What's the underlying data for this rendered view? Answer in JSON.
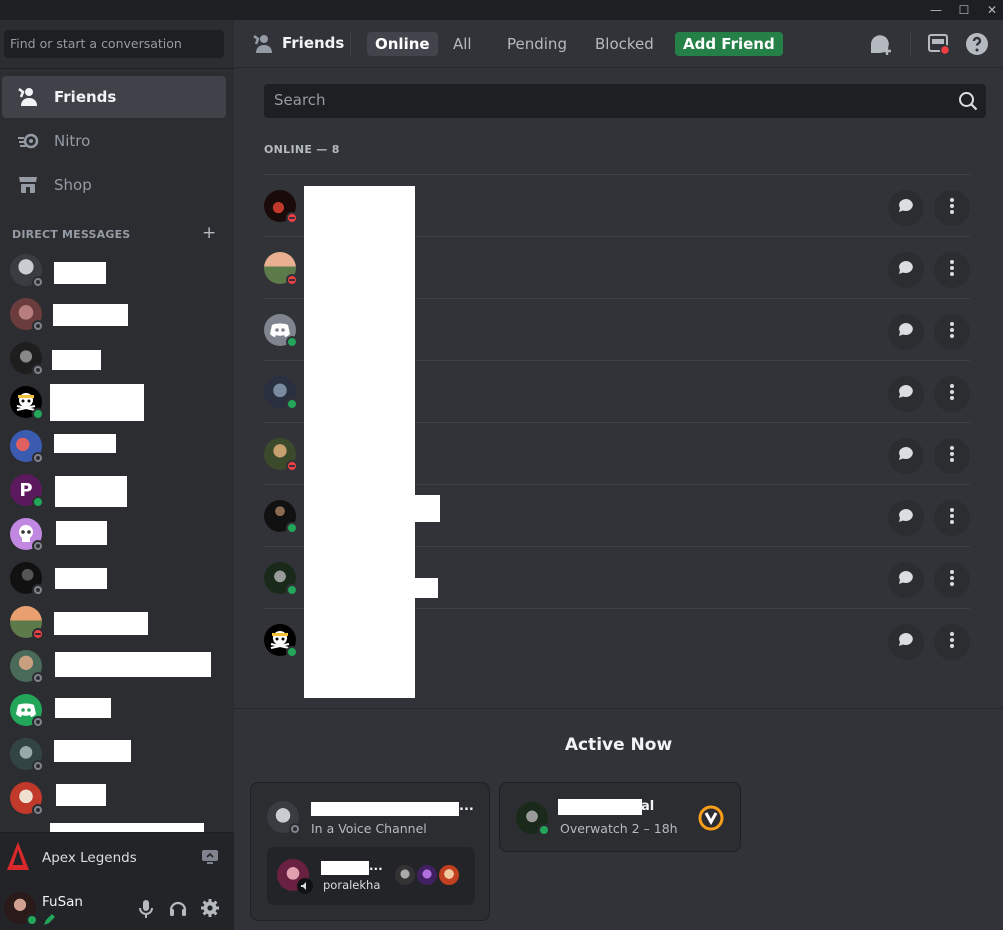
{
  "window": {
    "minimize": "—",
    "maximize": "☐",
    "close": "✕"
  },
  "sidebar": {
    "search_placeholder": "Find or start a conversation",
    "nav": [
      {
        "label": "Friends",
        "icon": "friends-icon",
        "active": true
      },
      {
        "label": "Nitro",
        "icon": "nitro-icon",
        "active": false
      },
      {
        "label": "Shop",
        "icon": "shop-icon",
        "active": false
      }
    ],
    "dm_header": "DIRECT MESSAGES",
    "dm_add": "+",
    "dms": [
      {
        "status": "offline"
      },
      {
        "status": "offline"
      },
      {
        "status": "offline"
      },
      {
        "status": "online"
      },
      {
        "status": "offline"
      },
      {
        "status": "online"
      },
      {
        "status": "offline"
      },
      {
        "status": "offline"
      },
      {
        "status": "dnd"
      },
      {
        "status": "offline"
      },
      {
        "status": "offline"
      },
      {
        "status": "offline"
      },
      {
        "status": "offline"
      }
    ],
    "game": {
      "name": "Apex Legends"
    },
    "user": {
      "name": "FuSan",
      "status": "online"
    }
  },
  "topbar": {
    "title": "Friends",
    "tabs": [
      {
        "label": "Online",
        "selected": true
      },
      {
        "label": "All",
        "selected": false
      },
      {
        "label": "Pending",
        "selected": false
      },
      {
        "label": "Blocked",
        "selected": false
      }
    ],
    "add_friend": "Add Friend"
  },
  "main": {
    "search_placeholder": "Search",
    "online_header": "ONLINE — 8",
    "friends": [
      {
        "status": "dnd"
      },
      {
        "status": "dnd"
      },
      {
        "status": "online"
      },
      {
        "status": "online"
      },
      {
        "status": "dnd"
      },
      {
        "status": "online"
      },
      {
        "status": "online"
      },
      {
        "status": "online"
      }
    ]
  },
  "active_now": {
    "title": "Active Now",
    "card1": {
      "subtitle": "In a Voice Channel",
      "name_suffix": "...",
      "voice_user_suffix": "...",
      "voice_user": "poralekha"
    },
    "card2": {
      "name_suffix": "al",
      "game": "Overwatch 2 – 18h"
    }
  },
  "colors": {
    "online": "#23a55a",
    "dnd": "#f23f43",
    "offline": "#80848e",
    "add_friend_bg": "#248046",
    "background": "#313338",
    "sidebar": "#2b2d31"
  }
}
